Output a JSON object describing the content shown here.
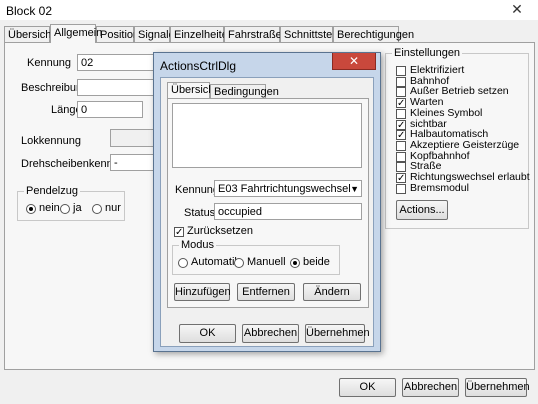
{
  "window": {
    "title": "Block 02",
    "close_glyph": "✕"
  },
  "tabs": [
    "Übersicht",
    "Allgemein",
    "Position",
    "Signale",
    "Einzelheiten",
    "Fahrstraßen",
    "Schnittstelle",
    "Berechtigungen"
  ],
  "form": {
    "kennung_label": "Kennung",
    "kennung_value": "02",
    "beschreibung_label": "Beschreibung",
    "beschreibung_value": "",
    "laenge_label": "Länge",
    "laenge_value": "0",
    "lokkennung_label": "Lokkennung",
    "drehscheibe_label": "Drehscheibenkennung",
    "drehscheibe_value": "-"
  },
  "pendelzug": {
    "title": "Pendelzug",
    "options": [
      "nein",
      "ja",
      "nur"
    ],
    "selected": "nein"
  },
  "settings": {
    "title": "Einstellungen",
    "items": [
      {
        "label": "Elektrifiziert",
        "checked": false
      },
      {
        "label": "Bahnhof",
        "checked": false
      },
      {
        "label": "Außer Betrieb setzen",
        "checked": false
      },
      {
        "label": "Warten",
        "checked": true
      },
      {
        "label": "Kleines Symbol",
        "checked": false
      },
      {
        "label": "sichtbar",
        "checked": true
      },
      {
        "label": "Halbautomatisch",
        "checked": true
      },
      {
        "label": "Akzeptiere Geisterzüge",
        "checked": false
      },
      {
        "label": "Kopfbahnhof",
        "checked": false
      },
      {
        "label": "Straße",
        "checked": false
      },
      {
        "label": "Richtungswechsel erlaubt",
        "checked": true
      },
      {
        "label": "Bremsmodul",
        "checked": false
      }
    ],
    "actions_label": "Actions..."
  },
  "buttons": {
    "ok": "OK",
    "cancel": "Abbrechen",
    "apply": "Übernehmen"
  },
  "dialog": {
    "title": "ActionsCtrlDlg",
    "close_glyph": "✕",
    "tabs": [
      "Übersicht",
      "Bedingungen"
    ],
    "kennung_label": "Kennung",
    "kennung_value": "E03 Fahrtrichtungswechsel",
    "dropdown_glyph": "▼",
    "status_label": "Status",
    "status_value": "occupied",
    "reset_label": "Zurücksetzen",
    "reset_checked": true,
    "modus_title": "Modus",
    "modus_options": [
      "Automatik",
      "Manuell",
      "beide"
    ],
    "modus_selected": "beide",
    "add_label": "Hinzufügen",
    "remove_label": "Entfernen",
    "edit_label": "Ändern",
    "ok": "OK",
    "cancel": "Abbrechen",
    "apply": "Übernehmen"
  },
  "colors": {
    "dialog_frame": "#c6d6ea",
    "close_red": "#c9483c"
  }
}
